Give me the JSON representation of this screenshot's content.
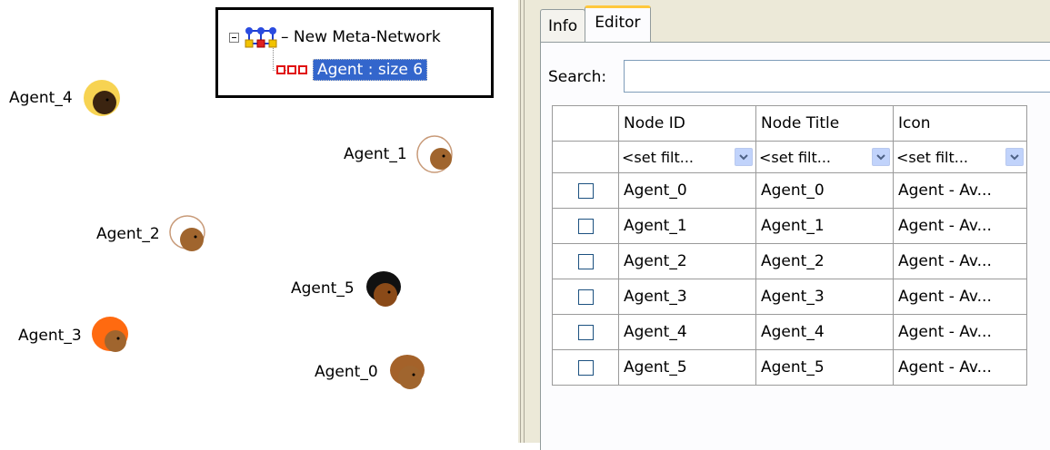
{
  "canvas": {
    "agents": [
      {
        "label": "Agent_4",
        "hair": "#f7d352",
        "skin": "#3b2410"
      },
      {
        "label": "Agent_1",
        "hair": "#ffffff",
        "skin": "#a0652e"
      },
      {
        "label": "Agent_2",
        "hair": "#ffffff",
        "skin": "#a0652e"
      },
      {
        "label": "Agent_5",
        "hair": "#111111",
        "skin": "#8a4a18"
      },
      {
        "label": "Agent_3",
        "hair": "#ff6a10",
        "skin": "#a0652e"
      },
      {
        "label": "Agent_0",
        "hair": "#a4622a",
        "skin": "#a0652e"
      }
    ]
  },
  "tree": {
    "root_label": "New Meta-Network",
    "child_label": "Agent : size 6"
  },
  "panel": {
    "tabs": [
      {
        "label": "Info",
        "active": false
      },
      {
        "label": "Editor",
        "active": true
      }
    ],
    "search": {
      "label": "Search:",
      "value": ""
    },
    "grid": {
      "columns": [
        "",
        "Node ID",
        "Node Title",
        "Icon"
      ],
      "filters": [
        "<set filt...",
        "<set filt...",
        "<set filt..."
      ],
      "rows": [
        {
          "checked": false,
          "id": "Agent_0",
          "title": "Agent_0",
          "icon": "Agent - Av..."
        },
        {
          "checked": false,
          "id": "Agent_1",
          "title": "Agent_1",
          "icon": "Agent - Av..."
        },
        {
          "checked": false,
          "id": "Agent_2",
          "title": "Agent_2",
          "icon": "Agent - Av..."
        },
        {
          "checked": false,
          "id": "Agent_3",
          "title": "Agent_3",
          "icon": "Agent - Av..."
        },
        {
          "checked": false,
          "id": "Agent_4",
          "title": "Agent_4",
          "icon": "Agent - Av..."
        },
        {
          "checked": false,
          "id": "Agent_5",
          "title": "Agent_5",
          "icon": "Agent - Av..."
        }
      ]
    }
  }
}
